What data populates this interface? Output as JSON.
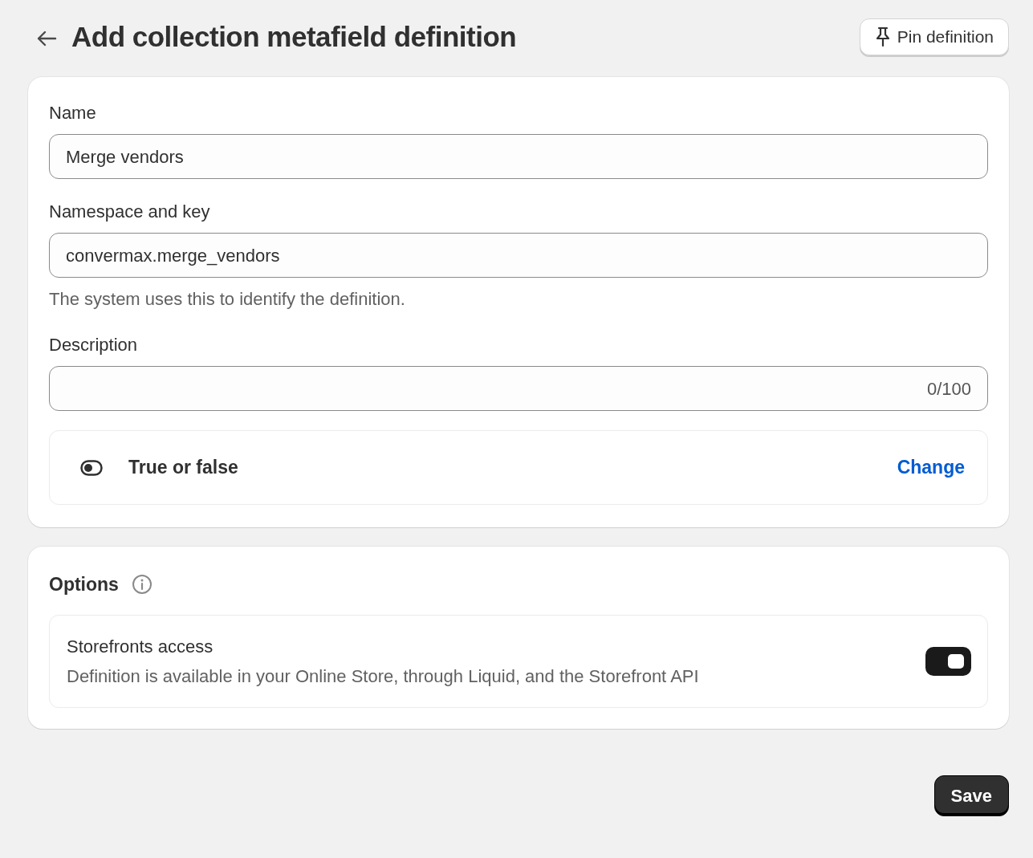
{
  "header": {
    "title": "Add collection metafield definition",
    "pin_button": "Pin definition"
  },
  "fields": [
    {
      "label": "Name",
      "value": "Merge vendors"
    },
    {
      "label": "Namespace and key",
      "value": "convermax.merge_vendors",
      "help": "The system uses this to identify the definition."
    },
    {
      "label": "Description",
      "counter": "0/100"
    }
  ],
  "type_row": {
    "label": "True or false",
    "action": "Change"
  },
  "options": {
    "title": "Options",
    "items": [
      {
        "title": "Storefronts access",
        "description": "Definition is available in your Online Store, through Liquid, and the Storefront API",
        "on": true
      }
    ]
  },
  "save_button": "Save"
}
